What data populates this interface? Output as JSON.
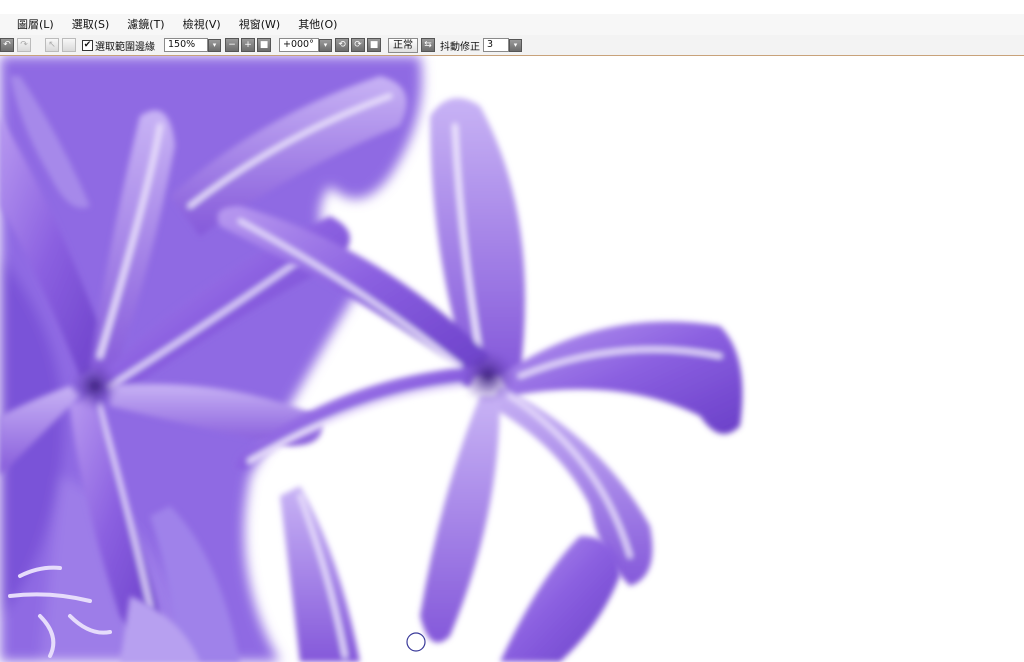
{
  "menubar": {
    "items": [
      {
        "label": "圖層(L)"
      },
      {
        "label": "選取(S)"
      },
      {
        "label": "濾鏡(T)"
      },
      {
        "label": "檢視(V)"
      },
      {
        "label": "視窗(W)"
      },
      {
        "label": "其他(O)"
      }
    ]
  },
  "toolbar": {
    "undo_icon": "↶",
    "redo_icon": "↷",
    "select_icon": "↖",
    "checkbox_mark": "✔",
    "antialias_label": "選取範圍邊緣",
    "zoom_value": "150%",
    "dropdown_arrow": "▾",
    "zoom_out_icon": "−",
    "zoom_in_icon": "+",
    "stop_icon": "■",
    "rotation_value": "+000°",
    "rotate_icon": "⟲",
    "fit_icon": "🔍",
    "blend_label": "正常",
    "flip_icon": "⇆",
    "stabilizer_label": "抖動修正",
    "stabilizer_value": "3"
  },
  "canvas": {
    "background": "#ffffff",
    "accent_colors": [
      "#7b4fd6",
      "#9b7ae6",
      "#c7b4f2",
      "#4a2a8a"
    ]
  }
}
